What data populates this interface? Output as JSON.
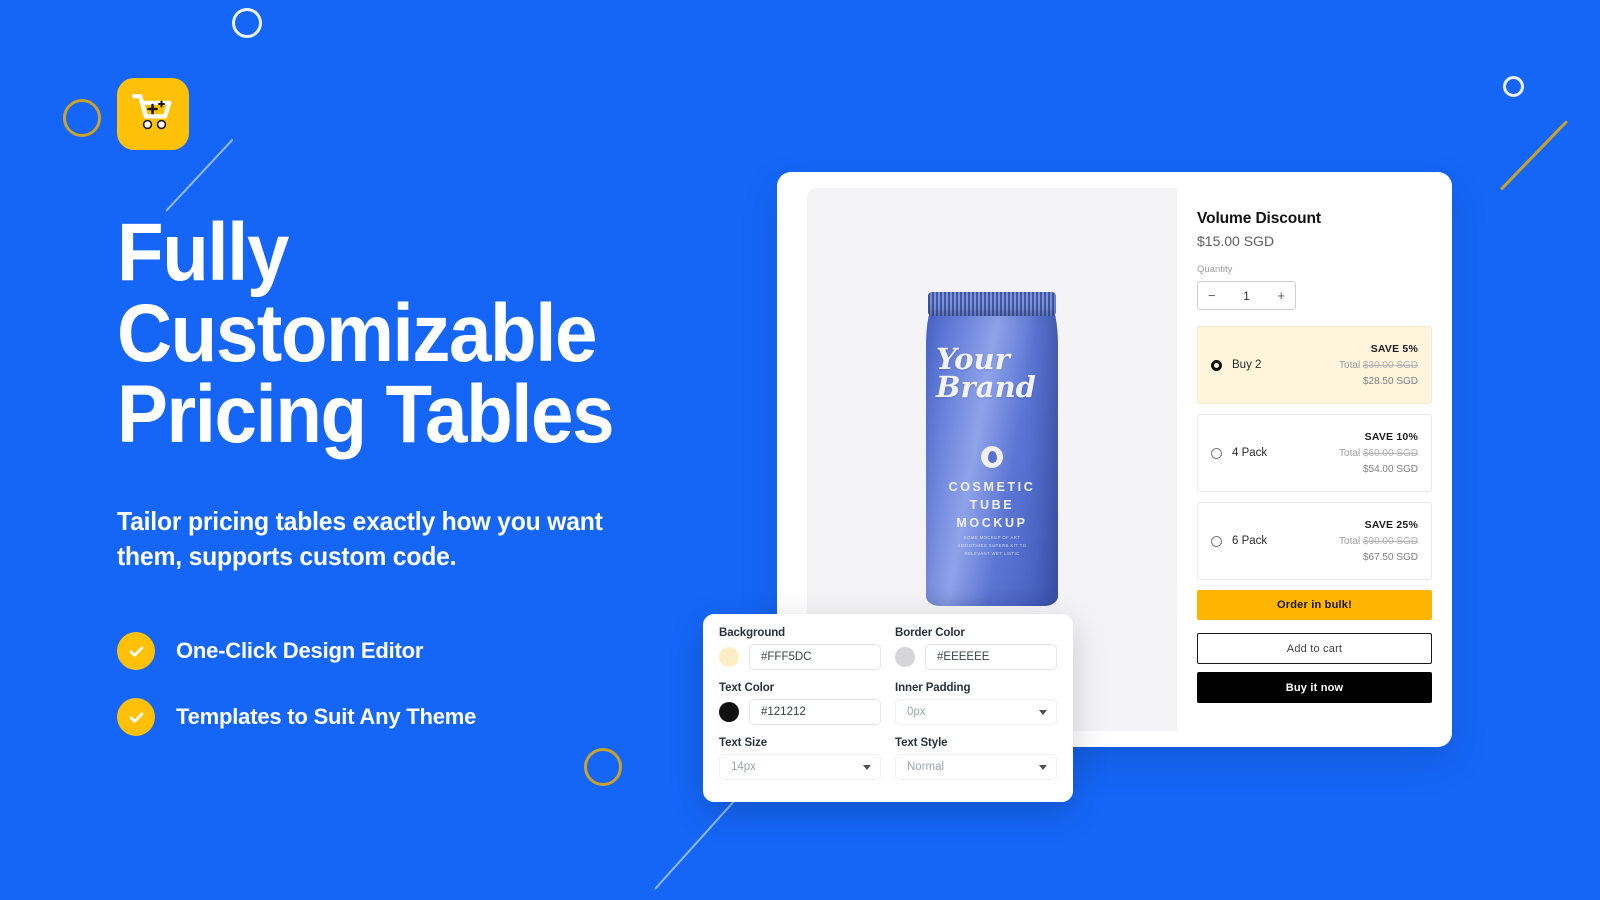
{
  "brand": {
    "logo_icon": "shopping-cart-plus-icon"
  },
  "hero": {
    "headline": "Fully Customizable\nPricing Tables",
    "subhead": "Tailor pricing tables exactly how you want\nthem, supports custom code.",
    "features": [
      {
        "icon": "check-icon",
        "label": "One-Click Design Editor"
      },
      {
        "icon": "check-icon",
        "label": "Templates to Suit Any Theme"
      }
    ]
  },
  "product_preview": {
    "tube": {
      "script_line1": "Your",
      "script_line2": "Brand",
      "title": "COSMETIC\nTUBE\nMOCKUP",
      "fineprint": "SOME MOCKUP OF ART\nSMOOTHIES SUPERB KIT TO\nRELEVANT WET LISTIC",
      "emblem_icon": "leaf-emblem-icon"
    }
  },
  "buy_box": {
    "title": "Volume Discount",
    "price": "$15.00 SGD",
    "quantity_label": "Quantity",
    "quantity": {
      "decrement_icon": "minus-icon",
      "value": "1",
      "increment_icon": "plus-icon"
    },
    "tiers": [
      {
        "name": "Buy 2",
        "save": "SAVE 5%",
        "total_label": "Total",
        "total_struck": "$30.00 SGD",
        "final": "$28.50 SGD",
        "selected": true
      },
      {
        "name": "4 Pack",
        "save": "SAVE 10%",
        "total_label": "Total",
        "total_struck": "$60.00 SGD",
        "final": "$54.00 SGD",
        "selected": false
      },
      {
        "name": "6 Pack",
        "save": "SAVE 25%",
        "total_label": "Total",
        "total_struck": "$90.00 SGD",
        "final": "$67.50 SGD",
        "selected": false
      }
    ],
    "bulk_button": "Order in bulk!",
    "add_to_cart_button": "Add to cart",
    "buy_now_button": "Buy it now"
  },
  "settings_panel": {
    "background": {
      "label": "Background",
      "value": "#FFF5DC",
      "swatch_color": "#FCEFC8"
    },
    "border_color": {
      "label": "Border Color",
      "value": "#EEEEEE",
      "swatch_color": "#D6D6D8"
    },
    "text_color": {
      "label": "Text Color",
      "value": "#121212",
      "swatch_color": "#111111"
    },
    "inner_padding": {
      "label": "Inner Padding",
      "value": "0px"
    },
    "text_size": {
      "label": "Text Size",
      "value": "14px"
    },
    "text_style": {
      "label": "Text Style",
      "value": "Normal"
    }
  },
  "theme": {
    "page_background": "#1566F7",
    "accent_yellow": "#FFC107",
    "bulk_button": "#FFB400",
    "tier_highlight": "#FFF5DC",
    "buy_now": "#000000",
    "deco_gold": "#C9A227"
  }
}
